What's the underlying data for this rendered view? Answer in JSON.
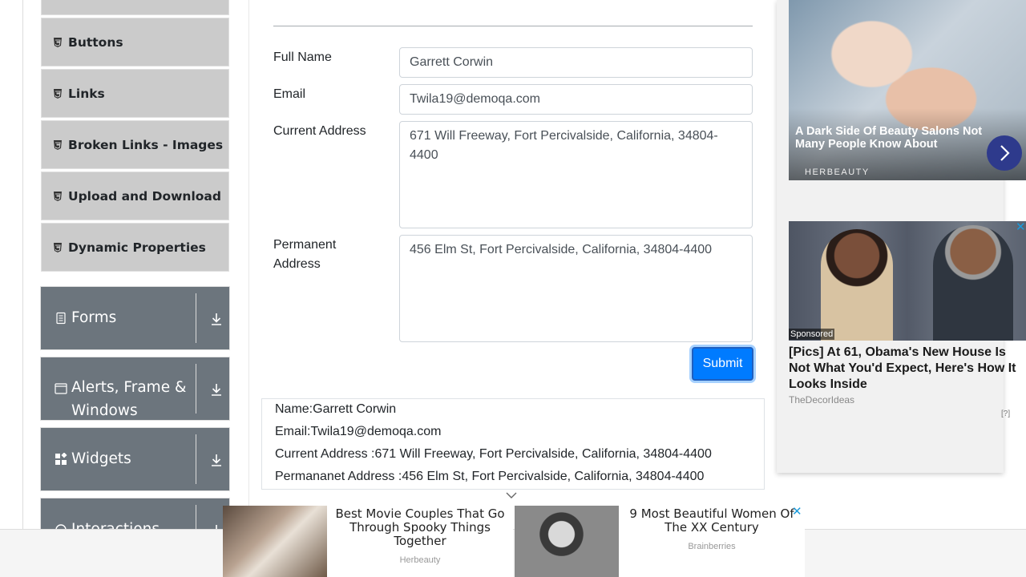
{
  "sidebar": {
    "elements_items": [
      {
        "label": "Buttons",
        "icon": "html5-icon"
      },
      {
        "label": "Links",
        "icon": "html5-icon"
      },
      {
        "label": "Broken Links - Images",
        "icon": "html5-icon"
      },
      {
        "label": "Upload and Download",
        "icon": "html5-icon"
      },
      {
        "label": "Dynamic Properties",
        "icon": "html5-icon"
      }
    ],
    "groups": [
      {
        "label": "Forms",
        "icon": "document-icon"
      },
      {
        "label": "Alerts, Frame & Windows",
        "icon": "window-icon"
      },
      {
        "label": "Widgets",
        "icon": "widgets-icon"
      },
      {
        "label": "Interactions",
        "icon": "interactions-icon"
      }
    ],
    "group_bg": "#6c757d",
    "item_bg": "#cbcbcb"
  },
  "form": {
    "full_name_label": "Full Name",
    "full_name_value": "Garrett Corwin",
    "email_label": "Email",
    "email_value": "Twila19@demoqa.com",
    "current_address_label": "Current Address",
    "current_address_value": "671 Will Freeway, Fort Percivalside, California, 34804-4400",
    "permanent_address_label": "Permanent Address",
    "permanent_address_value": "456 Elm St, Fort Percivalside, California, 34804-4400",
    "submit_label": "Submit",
    "submit_color": "#007bff"
  },
  "output": {
    "name": "Name:Garrett Corwin",
    "email": "Email:Twila19@demoqa.com",
    "current_address": "Current Address :671 Will Freeway, Fort Percivalside, California, 34804-4400",
    "permanent_address": "Permananet Address :456 Elm St, Fort Percivalside, California, 34804-4400"
  },
  "ads": {
    "right_top": {
      "title": "A Dark Side Of Beauty Salons Not Many People Know About",
      "brand": "HERBEAUTY"
    },
    "right_second": {
      "sponsored": "Sponsored",
      "title": "[Pics] At 61, Obama's New House Is Not What You'd Expect, Here's How It Looks Inside",
      "source": "TheDecorIdeas",
      "info": "[?]"
    },
    "bottom": [
      {
        "title": "Best Movie Couples That Go Through Spooky Things Together",
        "source": "Herbeauty"
      },
      {
        "title": "9 Most Beautiful Women Of The XX Century",
        "source": "Brainberries"
      }
    ]
  }
}
